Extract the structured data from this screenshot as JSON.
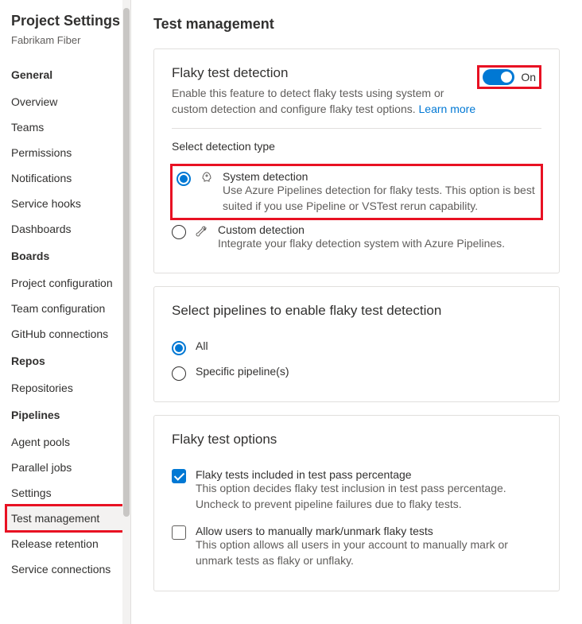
{
  "sidebar": {
    "title": "Project Settings",
    "subtitle": "Fabrikam Fiber",
    "groups": [
      {
        "header": "General",
        "items": [
          "Overview",
          "Teams",
          "Permissions",
          "Notifications",
          "Service hooks",
          "Dashboards"
        ]
      },
      {
        "header": "Boards",
        "items": [
          "Project configuration",
          "Team configuration",
          "GitHub connections"
        ]
      },
      {
        "header": "Repos",
        "items": [
          "Repositories"
        ]
      },
      {
        "header": "Pipelines",
        "items": [
          "Agent pools",
          "Parallel jobs",
          "Settings",
          "Test management",
          "Release retention",
          "Service connections"
        ]
      }
    ],
    "selected": "Test management"
  },
  "page": {
    "title": "Test management"
  },
  "flaky": {
    "title": "Flaky test detection",
    "description": "Enable this feature to detect flaky tests using system or custom detection and configure flaky test options.",
    "learn_more": "Learn more",
    "toggle_label": "On",
    "detection_header": "Select detection type",
    "system": {
      "title": "System detection",
      "desc": "Use Azure Pipelines detection for flaky tests. This option is best suited if you use Pipeline or VSTest rerun capability."
    },
    "custom": {
      "title": "Custom detection",
      "desc": "Integrate your flaky detection system with Azure Pipelines."
    }
  },
  "pipelines": {
    "title": "Select pipelines to enable flaky test detection",
    "all": "All",
    "specific": "Specific pipeline(s)"
  },
  "options": {
    "title": "Flaky test options",
    "opt1_title": "Flaky tests included in test pass percentage",
    "opt1_desc": "This option decides flaky test inclusion in test pass percentage. Uncheck to prevent pipeline failures due to flaky tests.",
    "opt2_title": "Allow users to manually mark/unmark flaky tests",
    "opt2_desc": "This option allows all users in your account to manually mark or unmark tests as flaky or unflaky."
  }
}
